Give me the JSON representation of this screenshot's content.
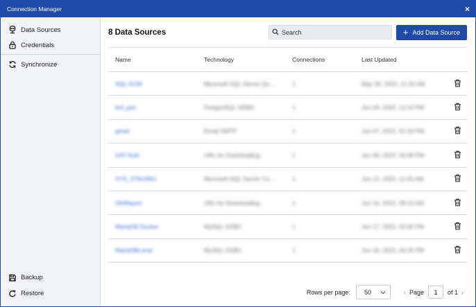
{
  "window": {
    "title": "Connection Manager",
    "close_glyph": "×"
  },
  "sidebar": {
    "items": [
      {
        "label": "Data Sources",
        "icon": "database-icon"
      },
      {
        "label": "Credentials",
        "icon": "lock-icon"
      },
      {
        "label": "Synchronize",
        "icon": "sync-icon"
      }
    ],
    "bottom": [
      {
        "label": "Backup",
        "icon": "save-icon"
      },
      {
        "label": "Restore",
        "icon": "restore-icon"
      }
    ]
  },
  "main": {
    "heading": "8 Data Sources",
    "search": {
      "placeholder": "Search",
      "value": ""
    },
    "add_button": {
      "label": "Add Data Source",
      "icon": "plus-icon"
    },
    "columns": [
      "Name",
      "Technology",
      "Connections",
      "Last Updated"
    ],
    "rows": [
      {
        "name": "SQL DCM",
        "technology": "Microsoft SQL Server Qu...",
        "connections": "1",
        "updated": "May 30, 2022, 11:20 AM"
      },
      {
        "name": "bnf_pec",
        "technology": "PostgreSQL ODBC",
        "connections": "1",
        "updated": "Jun 04, 2022, 12:10 PM"
      },
      {
        "name": "gmail",
        "technology": "Email SMTP",
        "connections": "1",
        "updated": "Jun 07, 2022, 01:20 PM"
      },
      {
        "name": "SAT Auth",
        "technology": "URL for Downloading",
        "connections": "1",
        "updated": "Jun 09, 2022, 03:39 PM"
      },
      {
        "name": "SYS_STAGING",
        "technology": "Microsoft SQL Server Co...",
        "connections": "1",
        "updated": "Jun 12, 2022, 11:03 AM"
      },
      {
        "name": "OHReport",
        "technology": "URL for Downloading",
        "connections": "1",
        "updated": "Jun 13, 2022, 09:13 AM"
      },
      {
        "name": "MariaDB Docker",
        "technology": "MySQL ODBC",
        "connections": "1",
        "updated": "Jun 17, 2022, 02:40 PM"
      },
      {
        "name": "MariaDBLocal",
        "technology": "MySQL ODBC",
        "connections": "1",
        "updated": "Jun 18, 2022, 04:26 PM"
      }
    ],
    "row_action_icon": "trash-icon"
  },
  "pagination": {
    "rows_label": "Rows per page:",
    "rows_value": "50",
    "page_label": "Page",
    "page_value": "1",
    "of_label": "of 1",
    "prev_glyph": "‹",
    "next_glyph": "›"
  },
  "colors": {
    "accent": "#1f4aa8",
    "link": "#2f63d1",
    "sidebar_bg": "#f3f4f8"
  }
}
